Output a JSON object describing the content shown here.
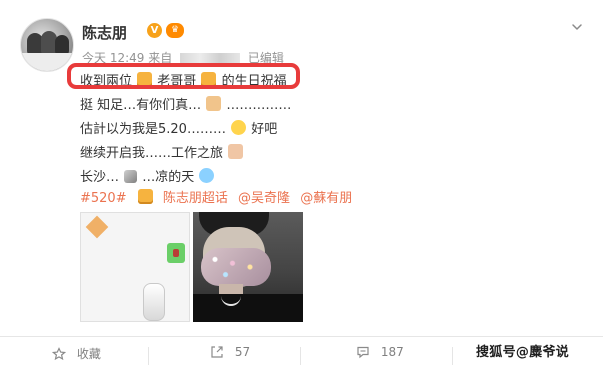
{
  "user": {
    "name": "陈志朋",
    "verified_mark": "V",
    "vip_mark": "♛"
  },
  "meta": {
    "time": "今天 12:49",
    "source_prefix": "来自",
    "edited": "已编辑"
  },
  "post": {
    "line1": {
      "t1": "收到兩位",
      "t2": "老哥哥",
      "t3": "的生日祝福"
    },
    "line2": {
      "t1": "挺 知足…有你们真…",
      "t2": "……………"
    },
    "line3": {
      "t1": "估計以为我是5.20………",
      "t2": "好吧"
    },
    "line4": {
      "t1": "继续开启我……工作之旅"
    },
    "line5": {
      "t1": "长沙…",
      "t2": "…凉的天"
    },
    "tags": [
      "#520#",
      "陈志朋超话",
      "@吴奇隆",
      "@蘇有朋"
    ]
  },
  "actions": {
    "collect": "收藏",
    "forward_count": "57",
    "comment_count": "187"
  },
  "watermark": "搜狐号@麋爷说",
  "colors": {
    "tag": "#eb7350",
    "highlight": "#e83b3b",
    "verified": "#f7a21b",
    "vip": "#ff8a00"
  },
  "icons": [
    "chevron-down-icon",
    "star-icon",
    "share-icon",
    "comment-icon"
  ]
}
